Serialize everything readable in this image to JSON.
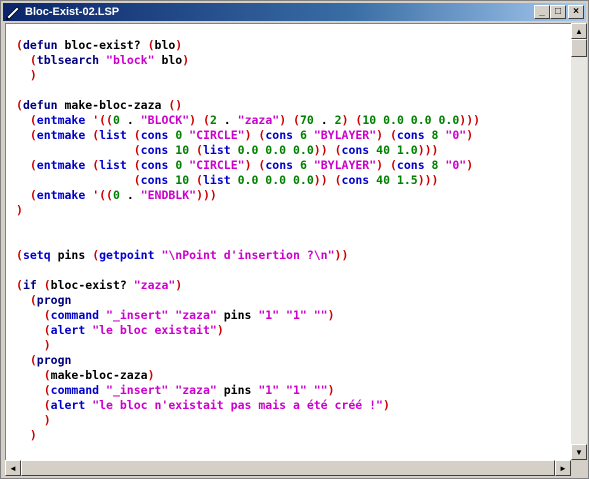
{
  "window": {
    "title": "Bloc-Exist-02.LSP",
    "buttons": {
      "minimize": "_",
      "maximize": "□",
      "close": "×"
    }
  },
  "editor": {
    "lines": [
      [
        [
          "paren",
          "("
        ],
        [
          "kw",
          "defun "
        ],
        [
          "id",
          "bloc-exist? "
        ],
        [
          "paren",
          "("
        ],
        [
          "id",
          "blo"
        ],
        [
          "paren",
          ")"
        ]
      ],
      [
        [
          "id",
          "  "
        ],
        [
          "paren",
          "("
        ],
        [
          "kw",
          "tblsearch "
        ],
        [
          "str",
          "\"block\" "
        ],
        [
          "id",
          "blo"
        ],
        [
          "paren",
          ")"
        ]
      ],
      [
        [
          "id",
          "  "
        ],
        [
          "paren",
          ")"
        ]
      ],
      [],
      [
        [
          "paren",
          "("
        ],
        [
          "kw",
          "defun "
        ],
        [
          "id",
          "make-bloc-zaza "
        ],
        [
          "paren",
          "()"
        ]
      ],
      [
        [
          "id",
          "  "
        ],
        [
          "paren",
          "("
        ],
        [
          "fn",
          "entmake "
        ],
        [
          "paren",
          "'(("
        ],
        [
          "num",
          "0 "
        ],
        [
          "id",
          ". "
        ],
        [
          "str",
          "\"BLOCK\""
        ],
        [
          "paren",
          ") ("
        ],
        [
          "num",
          "2 "
        ],
        [
          "id",
          ". "
        ],
        [
          "str",
          "\"zaza\""
        ],
        [
          "paren",
          ") ("
        ],
        [
          "num",
          "70 "
        ],
        [
          "id",
          ". "
        ],
        [
          "num",
          "2"
        ],
        [
          "paren",
          ") ("
        ],
        [
          "num",
          "10 0.0 0.0 0.0"
        ],
        [
          "paren",
          ")))"
        ]
      ],
      [
        [
          "id",
          "  "
        ],
        [
          "paren",
          "("
        ],
        [
          "fn",
          "entmake "
        ],
        [
          "paren",
          "("
        ],
        [
          "fn",
          "list "
        ],
        [
          "paren",
          "("
        ],
        [
          "fn",
          "cons "
        ],
        [
          "num",
          "0 "
        ],
        [
          "str",
          "\"CIRCLE\""
        ],
        [
          "paren",
          ") ("
        ],
        [
          "fn",
          "cons "
        ],
        [
          "num",
          "6 "
        ],
        [
          "str",
          "\"BYLAYER\""
        ],
        [
          "paren",
          ") ("
        ],
        [
          "fn",
          "cons "
        ],
        [
          "num",
          "8 "
        ],
        [
          "str",
          "\"0\""
        ],
        [
          "paren",
          ")"
        ]
      ],
      [
        [
          "id",
          "                 "
        ],
        [
          "paren",
          "("
        ],
        [
          "fn",
          "cons "
        ],
        [
          "num",
          "10 "
        ],
        [
          "paren",
          "("
        ],
        [
          "fn",
          "list "
        ],
        [
          "num",
          "0.0 0.0 0.0"
        ],
        [
          "paren",
          "))"
        ],
        [
          "id",
          " "
        ],
        [
          "paren",
          "("
        ],
        [
          "fn",
          "cons "
        ],
        [
          "num",
          "40 1.0"
        ],
        [
          "paren",
          ")))"
        ]
      ],
      [
        [
          "id",
          "  "
        ],
        [
          "paren",
          "("
        ],
        [
          "fn",
          "entmake "
        ],
        [
          "paren",
          "("
        ],
        [
          "fn",
          "list "
        ],
        [
          "paren",
          "("
        ],
        [
          "fn",
          "cons "
        ],
        [
          "num",
          "0 "
        ],
        [
          "str",
          "\"CIRCLE\""
        ],
        [
          "paren",
          ") ("
        ],
        [
          "fn",
          "cons "
        ],
        [
          "num",
          "6 "
        ],
        [
          "str",
          "\"BYLAYER\""
        ],
        [
          "paren",
          ") ("
        ],
        [
          "fn",
          "cons "
        ],
        [
          "num",
          "8 "
        ],
        [
          "str",
          "\"0\""
        ],
        [
          "paren",
          ")"
        ]
      ],
      [
        [
          "id",
          "                 "
        ],
        [
          "paren",
          "("
        ],
        [
          "fn",
          "cons "
        ],
        [
          "num",
          "10 "
        ],
        [
          "paren",
          "("
        ],
        [
          "fn",
          "list "
        ],
        [
          "num",
          "0.0 0.0 0.0"
        ],
        [
          "paren",
          "))"
        ],
        [
          "id",
          " "
        ],
        [
          "paren",
          "("
        ],
        [
          "fn",
          "cons "
        ],
        [
          "num",
          "40 1.5"
        ],
        [
          "paren",
          ")))"
        ]
      ],
      [
        [
          "id",
          "  "
        ],
        [
          "paren",
          "("
        ],
        [
          "fn",
          "entmake "
        ],
        [
          "paren",
          "'(("
        ],
        [
          "num",
          "0 "
        ],
        [
          "id",
          ". "
        ],
        [
          "str",
          "\"ENDBLK\""
        ],
        [
          "paren",
          ")))"
        ]
      ],
      [
        [
          "paren",
          ")"
        ]
      ],
      [],
      [],
      [
        [
          "paren",
          "("
        ],
        [
          "fn",
          "setq "
        ],
        [
          "id",
          "pins "
        ],
        [
          "paren",
          "("
        ],
        [
          "fn",
          "getpoint "
        ],
        [
          "str",
          "\"\\nPoint d'insertion ?\\n\""
        ],
        [
          "paren",
          "))"
        ]
      ],
      [],
      [
        [
          "paren",
          "("
        ],
        [
          "kw",
          "if "
        ],
        [
          "paren",
          "("
        ],
        [
          "id",
          "bloc-exist? "
        ],
        [
          "str",
          "\"zaza\""
        ],
        [
          "paren",
          ")"
        ]
      ],
      [
        [
          "id",
          "  "
        ],
        [
          "paren",
          "("
        ],
        [
          "kw",
          "progn"
        ]
      ],
      [
        [
          "id",
          "    "
        ],
        [
          "paren",
          "("
        ],
        [
          "fn",
          "command "
        ],
        [
          "str",
          "\"_insert\" \"zaza\" "
        ],
        [
          "id",
          "pins "
        ],
        [
          "str",
          "\"1\" \"1\" \"\""
        ],
        [
          "paren",
          ")"
        ]
      ],
      [
        [
          "id",
          "    "
        ],
        [
          "paren",
          "("
        ],
        [
          "fn",
          "alert "
        ],
        [
          "str",
          "\"le bloc existait\""
        ],
        [
          "paren",
          ")"
        ]
      ],
      [
        [
          "id",
          "    "
        ],
        [
          "paren",
          ")"
        ]
      ],
      [
        [
          "id",
          "  "
        ],
        [
          "paren",
          "("
        ],
        [
          "kw",
          "progn"
        ]
      ],
      [
        [
          "id",
          "    "
        ],
        [
          "paren",
          "("
        ],
        [
          "id",
          "make-bloc-zaza"
        ],
        [
          "paren",
          ")"
        ]
      ],
      [
        [
          "id",
          "    "
        ],
        [
          "paren",
          "("
        ],
        [
          "fn",
          "command "
        ],
        [
          "str",
          "\"_insert\" \"zaza\" "
        ],
        [
          "id",
          "pins "
        ],
        [
          "str",
          "\"1\" \"1\" \"\""
        ],
        [
          "paren",
          ")"
        ]
      ],
      [
        [
          "id",
          "    "
        ],
        [
          "paren",
          "("
        ],
        [
          "fn",
          "alert "
        ],
        [
          "str",
          "\"le bloc n'existait pas mais a été créé !\""
        ],
        [
          "paren",
          ")"
        ]
      ],
      [
        [
          "id",
          "    "
        ],
        [
          "paren",
          ")"
        ]
      ],
      [
        [
          "id",
          "  "
        ],
        [
          "paren",
          ")"
        ]
      ]
    ]
  },
  "scrollbars": {
    "up": "▲",
    "down": "▼",
    "left": "◄",
    "right": "►"
  },
  "colors": {
    "paren": "#cc0000",
    "keyword": "#000080",
    "function": "#0000cc",
    "string": "#cc00cc",
    "number": "#008000"
  }
}
